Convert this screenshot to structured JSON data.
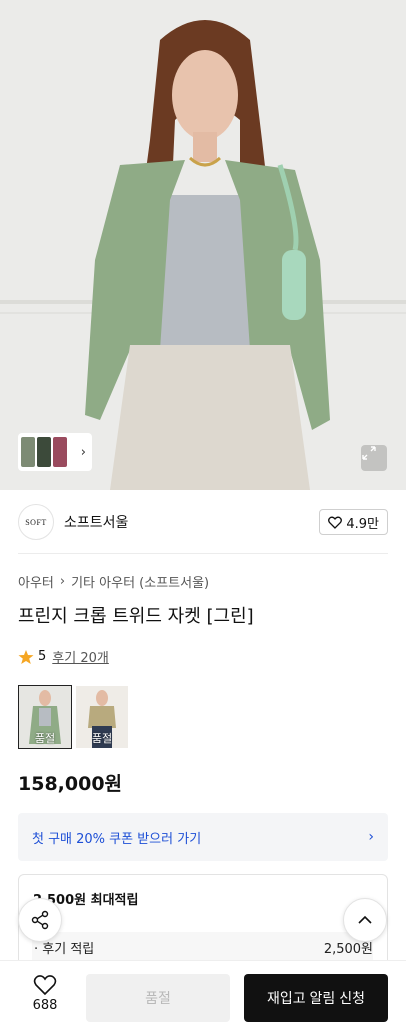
{
  "hero": {
    "gallery_thumb_colors": [
      "#7d8b74",
      "#3c4a3a",
      "#9a4b5e"
    ],
    "thumb_chevron": "›"
  },
  "brand": {
    "logo_text": "SOFT",
    "name": "소프트서울",
    "like_count": "4.9만"
  },
  "breadcrumb": {
    "level1": "아우터",
    "separator": "›",
    "level2": "기타 아우터 (소프트서울)"
  },
  "product": {
    "title": "프린지 크롭 트위드 자켓 [그린]",
    "rating": "5",
    "review_link": "후기 20개",
    "options": [
      {
        "label": "품절",
        "selected": true
      },
      {
        "label": "품절",
        "selected": false
      }
    ],
    "price": "158,000원"
  },
  "coupon": {
    "text": "첫 구매 20% 쿠폰 받으러 가기",
    "chevron": "›"
  },
  "points": {
    "title": "2,500원 최대적립",
    "row_label": "· 후기 적립",
    "row_value": "2,500원"
  },
  "bottom_bar": {
    "wish_count": "688",
    "soldout_label": "품절",
    "restock_label": "재입고 알림 신청"
  },
  "colors": {
    "accent_blue": "#1d4fd6",
    "star": "#f5a623",
    "jacket_green": "#8fab86"
  },
  "icons": [
    "chevron-right-icon",
    "expand-icon",
    "heart-icon",
    "star-icon",
    "share-icon",
    "chevron-up-icon"
  ]
}
